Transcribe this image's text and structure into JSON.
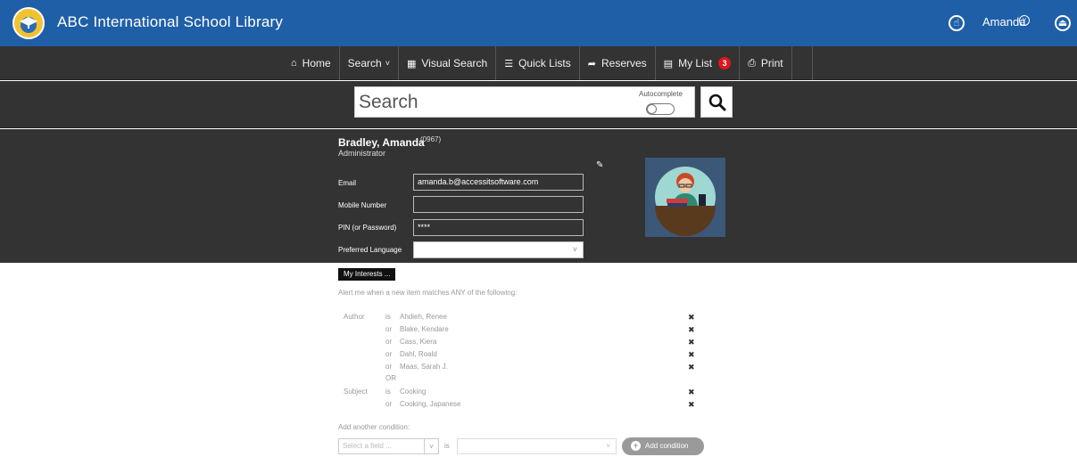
{
  "header": {
    "title": "ABC International School Library",
    "username": "Amanda",
    "icons": [
      "touch-icon",
      "chevron-down-icon",
      "logout-icon"
    ]
  },
  "nav": {
    "items": [
      {
        "label": "Home",
        "icon": "home-icon"
      },
      {
        "label": "Search",
        "icon": "chevron-down-icon"
      },
      {
        "label": "Visual Search",
        "icon": "grid-icon"
      },
      {
        "label": "Quick Lists",
        "icon": "list-icon"
      },
      {
        "label": "Reserves",
        "icon": "share-icon"
      },
      {
        "label": "My List",
        "icon": "list-box-icon",
        "badge": "3"
      },
      {
        "label": "Print",
        "icon": "print-icon"
      }
    ]
  },
  "search": {
    "placeholder": "Search",
    "autocomplete_label": "Autocomplete"
  },
  "profile": {
    "name": "Bradley, Amanda",
    "id": "(0967)",
    "role": "Administrator",
    "fields": {
      "email_label": "Email",
      "email_value": "amanda.b@accessitsoftware.com",
      "mobile_label": "Mobile Number",
      "mobile_value": "",
      "pin_label": "PIN (or Password)",
      "pin_value": "****",
      "language_label": "Preferred Language",
      "language_value": ""
    }
  },
  "interests": {
    "button_label": "My Interests ...",
    "alert_text": "Alert me when a new item matches ANY of the following:",
    "rows": [
      {
        "field": "Author",
        "op": "is",
        "value": "Ahdieh, Renee"
      },
      {
        "field": "",
        "op": "or",
        "value": "Blake, Kendare"
      },
      {
        "field": "",
        "op": "or",
        "value": "Cass, Kiera"
      },
      {
        "field": "",
        "op": "or",
        "value": "Dahl, Roald"
      },
      {
        "field": "",
        "op": "or",
        "value": "Maas, Sarah J."
      },
      {
        "field": "",
        "op": "OR",
        "value": ""
      },
      {
        "field": "Subject",
        "op": "is",
        "value": "Cooking"
      },
      {
        "field": "",
        "op": "or",
        "value": "Cooking, Japanese"
      }
    ],
    "add_label": "Add another condition:",
    "select_field_placeholder": "Select a field ...",
    "is_label": "is",
    "add_button": "Add condition"
  },
  "colors": {
    "header_bg": "#1f5fa8",
    "nav_bg": "#333333",
    "badge": "#e0141e"
  }
}
